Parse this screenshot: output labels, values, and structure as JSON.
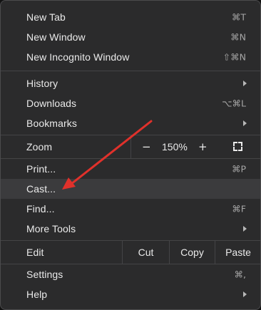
{
  "menu": {
    "items": [
      {
        "label": "New Tab",
        "shortcut": "⌘T"
      },
      {
        "label": "New Window",
        "shortcut": "⌘N"
      },
      {
        "label": "New Incognito Window",
        "shortcut": "⇧⌘N"
      },
      {
        "label": "History"
      },
      {
        "label": "Downloads",
        "shortcut": "⌥⌘L"
      },
      {
        "label": "Bookmarks"
      },
      {
        "label": "Print...",
        "shortcut": "⌘P"
      },
      {
        "label": "Cast..."
      },
      {
        "label": "Find...",
        "shortcut": "⌘F"
      },
      {
        "label": "More Tools"
      },
      {
        "label": "Settings",
        "shortcut": "⌘,"
      },
      {
        "label": "Help"
      }
    ],
    "zoom": {
      "label": "Zoom",
      "minus": "−",
      "value": "150%",
      "plus": "+"
    },
    "edit": {
      "label": "Edit",
      "cut": "Cut",
      "copy": "Copy",
      "paste": "Paste"
    }
  },
  "colors": {
    "menu_background": "#2b2b2c",
    "highlight": "#3b3b3d",
    "annotation_arrow": "#e0312b"
  },
  "icons": {
    "submenu": "chevron-right-icon",
    "fullscreen": "fullscreen-icon"
  }
}
